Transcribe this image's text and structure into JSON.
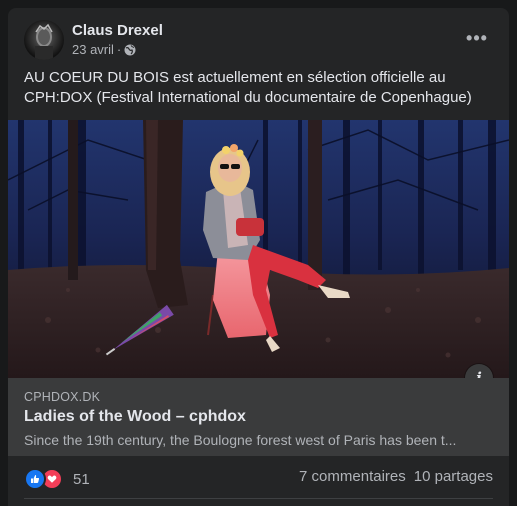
{
  "post": {
    "author": "Claus Drexel",
    "date": "23 avril",
    "separator": "·",
    "audience_icon": "globe-icon",
    "more_label": "•••",
    "text": "AU COEUR DU BOIS est actuellement en sélection officielle au CPH:DOX (Festival International du documentaire de Copenhague)"
  },
  "link": {
    "domain": "CPHDOX.DK",
    "title": "Ladies of the Wood – cphdox",
    "description": "Since the 19th century, the Boulogne forest west of Paris has been t...",
    "info_label": "i"
  },
  "stats": {
    "reaction_icons": [
      "like-icon",
      "love-icon"
    ],
    "reaction_count": "51",
    "comments": "7 commentaires",
    "shares": "10 partages"
  },
  "colors": {
    "card_bg": "#242526",
    "page_bg": "#18191a",
    "text_primary": "#e4e6eb",
    "text_secondary": "#b0b3b8",
    "like_blue": "#1877f2",
    "love_red": "#f33e58"
  }
}
